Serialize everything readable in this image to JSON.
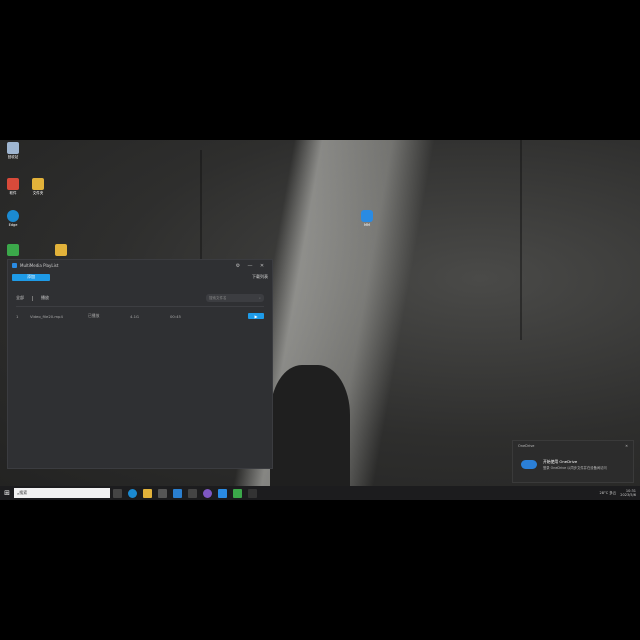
{
  "desktop": {
    "icons": [
      {
        "name": "recycle-bin",
        "label": "回收站",
        "color": "#9fb6d1"
      },
      {
        "name": "app-icon-1",
        "label": "软件",
        "color": "#d84a3a"
      },
      {
        "name": "folder-icon-1",
        "label": "文件夹",
        "color": "#e2b23a"
      },
      {
        "name": "edge-icon",
        "label": "Edge",
        "color": "#1b8ad1"
      },
      {
        "name": "app-icon-2",
        "label": "",
        "color": "#3ba84a"
      },
      {
        "name": "folder-icon-2",
        "label": "",
        "color": "#e2b23a"
      },
      {
        "name": "mm-app-icon",
        "label": "MM",
        "color": "#2a8be3"
      }
    ]
  },
  "window": {
    "title": "MultiMedia PlayList",
    "controls": {
      "settings": "⚙",
      "minimize": "—",
      "close": "✕"
    },
    "primary_button": "添加",
    "toolbar_link": "下载列表",
    "tabs": [
      "全部",
      "播放"
    ],
    "search_placeholder": "搜索文件名",
    "row": {
      "index": "1",
      "name": "Video_file20.mp4",
      "status": "已播放",
      "size": "4.1G",
      "duration": "00:45",
      "action": "▶"
    }
  },
  "notification": {
    "app": "OneDrive",
    "title": "开始使用 OneDrive",
    "body": "登录 OneDrive 以同步文件并在设备间访问"
  },
  "taskbar": {
    "search_placeholder": "搜索",
    "time": "10:31",
    "date": "2023/5/6",
    "tray_text": "28°C 多云"
  },
  "colors": {
    "accent": "#1e9be8",
    "window_bg": "#2f3033",
    "taskbar_bg": "#1c1c1e"
  }
}
